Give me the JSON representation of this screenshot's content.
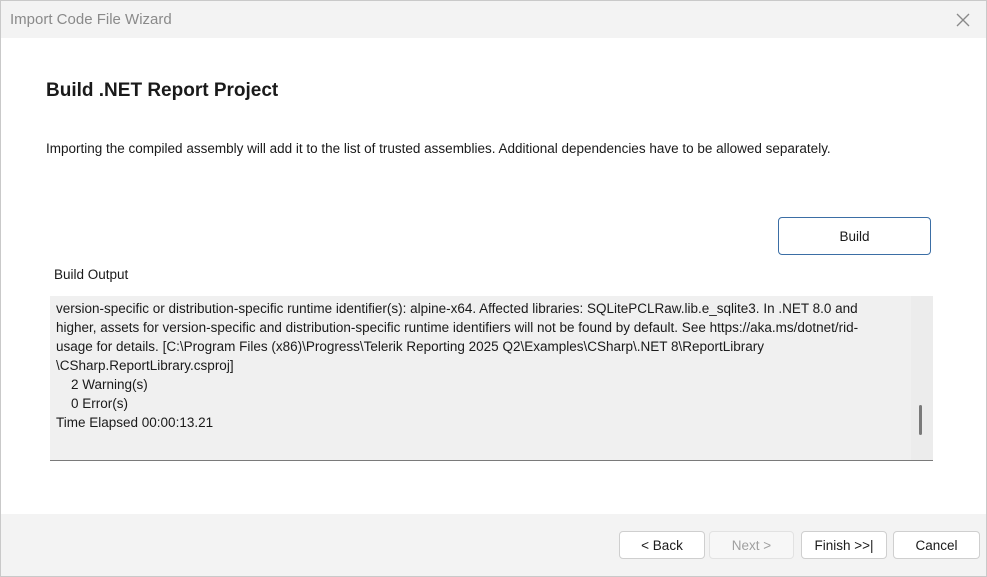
{
  "window": {
    "title": "Import Code File Wizard"
  },
  "page": {
    "title": "Build .NET Report Project",
    "description": "Importing the compiled assembly will add it to the list of trusted assemblies. Additional dependencies have to be allowed separately."
  },
  "build": {
    "button_label": "Build",
    "output_label": "Build Output",
    "output_lines": [
      "version-specific or distribution-specific runtime identifier(s): alpine-x64. Affected libraries: SQLitePCLRaw.lib.e_sqlite3. In .NET 8.0 and",
      "higher, assets for version-specific and distribution-specific runtime identifiers will not be found by default. See https://aka.ms/dotnet/rid-",
      "usage for details. [C:\\Program Files (x86)\\Progress\\Telerik Reporting 2025 Q2\\Examples\\CSharp\\.NET 8\\ReportLibrary",
      "\\CSharp.ReportLibrary.csproj]",
      "    2 Warning(s)",
      "    0 Error(s)",
      "Time Elapsed 00:00:13.21"
    ]
  },
  "footer": {
    "back_label": "< Back",
    "next_label": "Next >",
    "finish_label": "Finish >>|",
    "cancel_label": "Cancel"
  },
  "icons": {
    "close": "close-icon"
  },
  "colors": {
    "accent_border": "#3b6ea5",
    "title_bar": "#f3f3f3",
    "output_bg": "#f0f0f0"
  }
}
